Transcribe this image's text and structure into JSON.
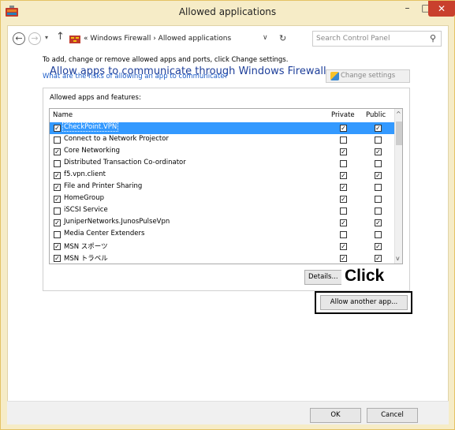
{
  "window": {
    "title": "Allowed applications",
    "minimize_label": "–",
    "maximize_label": "□",
    "close_label": "✕"
  },
  "address": {
    "back_symbol": "←",
    "forward_symbol": "→",
    "recent_symbol": "▾",
    "up_symbol": "↑",
    "breadcrumb": "« Windows Firewall › Allowed applications",
    "dropdown_symbol": "∨",
    "refresh_symbol": "↻",
    "search_placeholder": "Search Control Panel",
    "search_symbol": "⚲"
  },
  "main": {
    "heading": "Allow apps to communicate through Windows Firewall",
    "subtext": "To add, change or remove allowed apps and ports, click Change settings.",
    "risk_link": "What are the risks of allowing an app to communicate?",
    "change_settings_label": "Change settings",
    "group_label": "Allowed apps and features:",
    "columns": {
      "name": "Name",
      "private": "Private",
      "public": "Public"
    },
    "apps": [
      {
        "name": "CheckPoint.VPN",
        "enabled": "☑",
        "private": "☑",
        "public": "☑",
        "selected": true
      },
      {
        "name": "Connect to a Network Projector",
        "enabled": "☐",
        "private": "☐",
        "public": "☐"
      },
      {
        "name": "Core Networking",
        "enabled": "☑",
        "private": "☑",
        "public": "☑"
      },
      {
        "name": "Distributed Transaction Co-ordinator",
        "enabled": "☐",
        "private": "☐",
        "public": "☐"
      },
      {
        "name": "f5.vpn.client",
        "enabled": "☑",
        "private": "☑",
        "public": "☑"
      },
      {
        "name": "File and Printer Sharing",
        "enabled": "☑",
        "private": "☑",
        "public": "☐"
      },
      {
        "name": "HomeGroup",
        "enabled": "☑",
        "private": "☑",
        "public": "☐"
      },
      {
        "name": "iSCSI Service",
        "enabled": "☐",
        "private": "☐",
        "public": "☐"
      },
      {
        "name": "JuniperNetworks.JunosPulseVpn",
        "enabled": "☑",
        "private": "☑",
        "public": "☑"
      },
      {
        "name": "Media Center Extenders",
        "enabled": "☐",
        "private": "☐",
        "public": "☐"
      },
      {
        "name": "MSN スポーツ",
        "enabled": "☑",
        "private": "☑",
        "public": "☑"
      },
      {
        "name": "MSN トラベル",
        "enabled": "☑",
        "private": "☑",
        "public": "☑"
      }
    ],
    "scroll_up": "^",
    "scroll_down": "v",
    "details_label": "Details...",
    "click_callout": "Click",
    "allow_another_label": "Allow another app..."
  },
  "footer": {
    "ok_label": "OK",
    "cancel_label": "Cancel"
  }
}
